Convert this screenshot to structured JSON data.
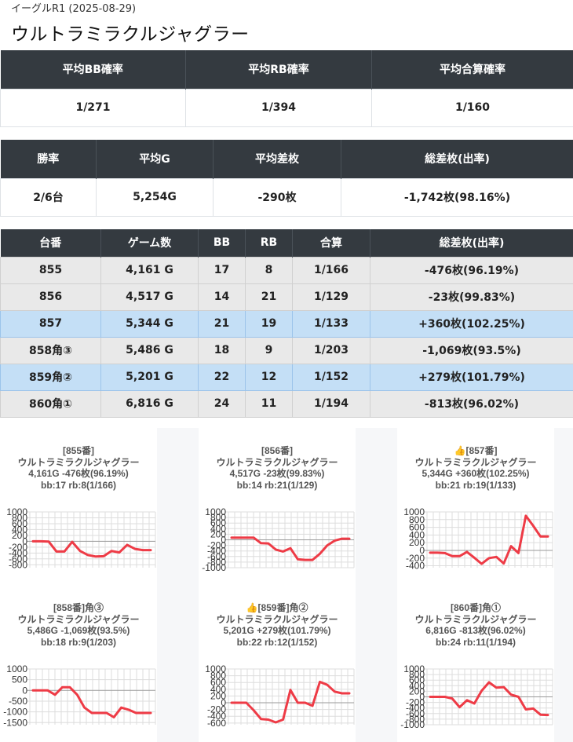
{
  "header": {
    "subtitle": "イーグルR1 (2025-08-29)",
    "title": "ウルトラミラクルジャグラー"
  },
  "summary1": {
    "headers": [
      "平均BB確率",
      "平均RB確率",
      "平均合算確率"
    ],
    "values": [
      "1/271",
      "1/394",
      "1/160"
    ]
  },
  "summary2": {
    "headers": [
      "勝率",
      "平均G",
      "平均差枚",
      "総差枚(出率)"
    ],
    "values": [
      "2/6台",
      "5,254G",
      "-290枚",
      "-1,742枚(98.16%)"
    ]
  },
  "machines": {
    "headers": [
      "台番",
      "ゲーム数",
      "BB",
      "RB",
      "合算",
      "総差枚(出率)"
    ],
    "rows": [
      {
        "cells": [
          "855",
          "4,161 G",
          "17",
          "8",
          "1/166",
          "-476枚(96.19%)"
        ],
        "highlight": false
      },
      {
        "cells": [
          "856",
          "4,517 G",
          "14",
          "21",
          "1/129",
          "-23枚(99.83%)"
        ],
        "highlight": false
      },
      {
        "cells": [
          "857",
          "5,344 G",
          "21",
          "19",
          "1/133",
          "+360枚(102.25%)"
        ],
        "highlight": true
      },
      {
        "cells": [
          "858角③",
          "5,486 G",
          "18",
          "9",
          "1/203",
          "-1,069枚(93.5%)"
        ],
        "highlight": false
      },
      {
        "cells": [
          "859角②",
          "5,201 G",
          "22",
          "12",
          "1/152",
          "+279枚(101.79%)"
        ],
        "highlight": true
      },
      {
        "cells": [
          "860角①",
          "6,816 G",
          "24",
          "11",
          "1/194",
          "-813枚(96.02%)"
        ],
        "highlight": false
      }
    ]
  },
  "colors": {
    "line": "#ee3b46",
    "highlight": "#c4dff6",
    "header_bg": "#343a40"
  },
  "chart_data": [
    {
      "type": "line",
      "caption": [
        "[855番]",
        "ウルトラミラクルジャグラー",
        "4,161G -476枚(96.19%)",
        "bb:17 rb:8(1/166)"
      ],
      "yticks": [
        "1000",
        "800",
        "600",
        "400",
        "200",
        "0",
        "-200",
        "-400",
        "-600",
        "-800"
      ],
      "ylim": [
        -900,
        1000
      ],
      "values": [
        0,
        0,
        -10,
        -350,
        -350,
        -20,
        -330,
        -470,
        -520,
        -510,
        -330,
        -380,
        -120,
        -260,
        -300,
        -300
      ]
    },
    {
      "type": "line",
      "caption": [
        "[856番]",
        "ウルトラミラクルジャグラー",
        "4,517G -23枚(99.83%)",
        "bb:14 rb:21(1/129)"
      ],
      "yticks": [
        "1000",
        "800",
        "600",
        "400",
        "200",
        "0",
        "-200",
        "-400",
        "-600",
        "-800",
        "-1000"
      ],
      "ylim": [
        -1000,
        1000
      ],
      "values": [
        80,
        80,
        80,
        80,
        -120,
        -130,
        -350,
        -420,
        -300,
        -700,
        -720,
        -720,
        -500,
        -200,
        -30,
        40,
        40
      ]
    },
    {
      "type": "line",
      "caption": [
        "👍[857番]",
        "ウルトラミラクルジャグラー",
        "5,344G +360枚(102.25%)",
        "bb:21 rb:19(1/133)"
      ],
      "yticks": [
        "1000",
        "800",
        "600",
        "400",
        "200",
        "0",
        "-200",
        "-400"
      ],
      "ylim": [
        -450,
        1000
      ],
      "values": [
        -60,
        -60,
        -70,
        -150,
        -150,
        -40,
        -190,
        -350,
        -200,
        -170,
        -340,
        110,
        -70,
        900,
        640,
        360,
        360
      ]
    },
    {
      "type": "line",
      "caption": [
        "[858番]角③",
        "ウルトラミラクルジャグラー",
        "5,486G -1,069枚(93.5%)",
        "bb:18 rb:9(1/203)"
      ],
      "yticks": [
        "1000",
        "500",
        "0",
        "-500",
        "-1000",
        "-1500"
      ],
      "ylim": [
        -1600,
        1000
      ],
      "values": [
        0,
        0,
        0,
        -200,
        150,
        150,
        -200,
        -800,
        -1050,
        -1050,
        -1050,
        -1250,
        -800,
        -900,
        -1050,
        -1050,
        -1050
      ]
    },
    {
      "type": "line",
      "caption": [
        "👍[859番]角②",
        "ウルトラミラクルジャグラー",
        "5,201G +279枚(101.79%)",
        "bb:22 rb:12(1/152)"
      ],
      "yticks": [
        "1000",
        "800",
        "600",
        "400",
        "200",
        "0",
        "-200",
        "-400",
        "-600"
      ],
      "ylim": [
        -650,
        1000
      ],
      "values": [
        0,
        0,
        0,
        -220,
        -480,
        -500,
        -580,
        -500,
        380,
        0,
        0,
        -90,
        620,
        530,
        330,
        280,
        280
      ]
    },
    {
      "type": "line",
      "caption": [
        "[860番]角①",
        "ウルトラミラクルジャグラー",
        "6,816G -813枚(96.02%)",
        "bb:24 rb:11(1/194)"
      ],
      "yticks": [
        "1000",
        "800",
        "600",
        "400",
        "200",
        "0",
        "-200",
        "-400",
        "-600",
        "-800",
        "-1000"
      ],
      "ylim": [
        -1000,
        1000
      ],
      "values": [
        0,
        0,
        0,
        -60,
        -370,
        -120,
        -240,
        220,
        520,
        330,
        350,
        80,
        0,
        -450,
        -420,
        -640,
        -650
      ]
    }
  ]
}
